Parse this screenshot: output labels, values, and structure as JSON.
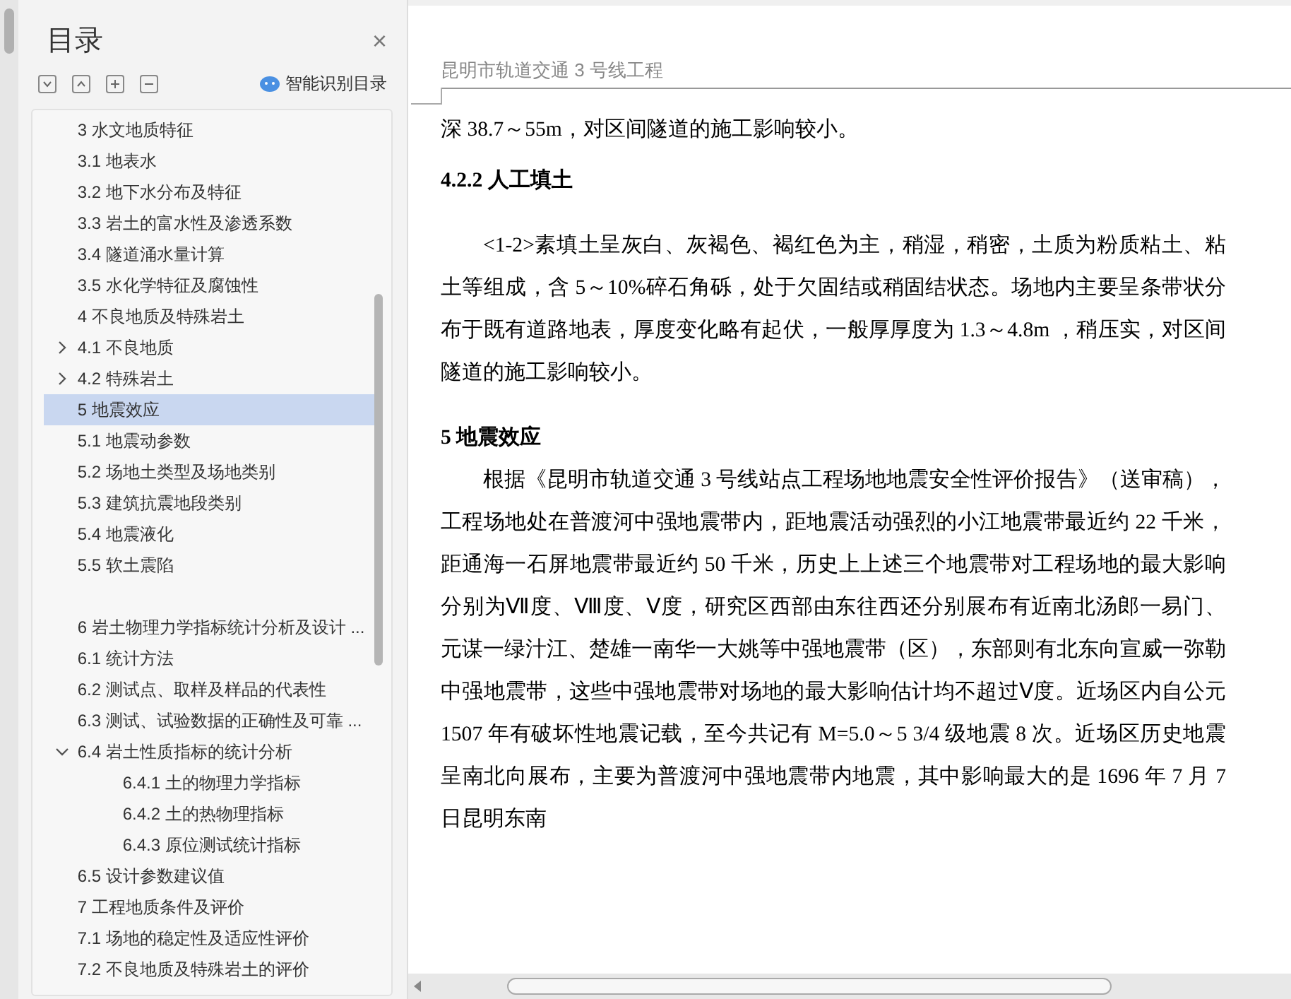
{
  "toc_panel": {
    "title": "目录",
    "close": "×",
    "smart_button": "智能识别目录",
    "items": [
      {
        "label": "3 水文地质特征",
        "selected": false
      },
      {
        "label": "3.1 地表水",
        "selected": false
      },
      {
        "label": "3.2 地下水分布及特征",
        "selected": false
      },
      {
        "label": "3.3 岩土的富水性及渗透系数",
        "selected": false
      },
      {
        "label": "3.4 隧道涌水量计算",
        "selected": false
      },
      {
        "label": "3.5 水化学特征及腐蚀性",
        "selected": false
      },
      {
        "label": "4 不良地质及特殊岩土",
        "selected": false
      },
      {
        "label": "4.1 不良地质",
        "selected": false,
        "expanded": false
      },
      {
        "label": "4.2 特殊岩土",
        "selected": false,
        "expanded": false
      },
      {
        "label": "5 地震效应",
        "selected": true
      },
      {
        "label": "5.1 地震动参数",
        "selected": false
      },
      {
        "label": "5.2 场地土类型及场地类别",
        "selected": false
      },
      {
        "label": "5.3 建筑抗震地段类别",
        "selected": false
      },
      {
        "label": "5.4 地震液化",
        "selected": false
      },
      {
        "label": "5.5 软土震陷",
        "selected": false
      },
      {
        "label": "6 岩土物理力学指标统计分析及设计 ...",
        "selected": false,
        "gap_before": true
      },
      {
        "label": "6.1 统计方法",
        "selected": false
      },
      {
        "label": "6.2 测试点、取样及样品的代表性",
        "selected": false
      },
      {
        "label": "6.3 测试、试验数据的正确性及可靠 ...",
        "selected": false
      },
      {
        "label": "6.4  岩土性质指标的统计分析",
        "selected": false,
        "expanded": true,
        "children": [
          {
            "label": "6.4.1 土的物理力学指标",
            "selected": false
          },
          {
            "label": "6.4.2 土的热物理指标",
            "selected": false
          },
          {
            "label": "6.4.3 原位测试统计指标",
            "selected": false
          }
        ]
      },
      {
        "label": "6.5 设计参数建议值",
        "selected": false
      },
      {
        "label": "7 工程地质条件及评价",
        "selected": false
      },
      {
        "label": "7.1 场地的稳定性及适应性评价",
        "selected": false
      },
      {
        "label": "7.2 不良地质及特殊岩土的评价",
        "selected": false
      }
    ]
  },
  "document": {
    "header": "昆明市轨道交通 3 号线工程",
    "blocks": [
      {
        "kind": "continuation",
        "text": "深 38.7～55m，对区间隧道的施工影响较小。"
      },
      {
        "kind": "heading",
        "text": "4.2.2 人工填土"
      },
      {
        "kind": "paragraph",
        "text": "<1-2>素填土呈灰白、灰褐色、褐红色为主，稍湿，稍密，土质为粉质粘土、粘土等组成，含 5～10%碎石角砾，处于欠固结或稍固结状态。场地内主要呈条带状分布于既有道路地表，厚度变化略有起伏，一般厚厚度为 1.3～4.8m ，稍压实，对区间隧道的施工影响较小。"
      },
      {
        "kind": "heading",
        "text": "5 地震效应"
      },
      {
        "kind": "paragraph",
        "text": "根据《昆明市轨道交通 3 号线站点工程场地地震安全性评价报告》（送审稿），工程场地处在普渡河中强地震带内，距地震活动强烈的小江地震带最近约 22 千米，距通海一石屏地震带最近约 50 千米，历史上上述三个地震带对工程场地的最大影响分别为Ⅶ度、Ⅷ度、Ⅴ度，研究区西部由东往西还分别展布有近南北汤郎一易门、元谋一绿汁江、楚雄一南华一大姚等中强地震带（区），东部则有北东向宣威一弥勒中强地震带，这些中强地震带对场地的最大影响估计均不超过Ⅴ度。近场区内自公元 1507 年有破坏性地震记载，至今共记有 M=5.0～5 3/4 级地震 8 次。近场区历史地震呈南北向展布，主要为普渡河中强地震带内地震，其中影响最大的是 1696 年 7 月 7 日昆明东南"
      }
    ]
  }
}
